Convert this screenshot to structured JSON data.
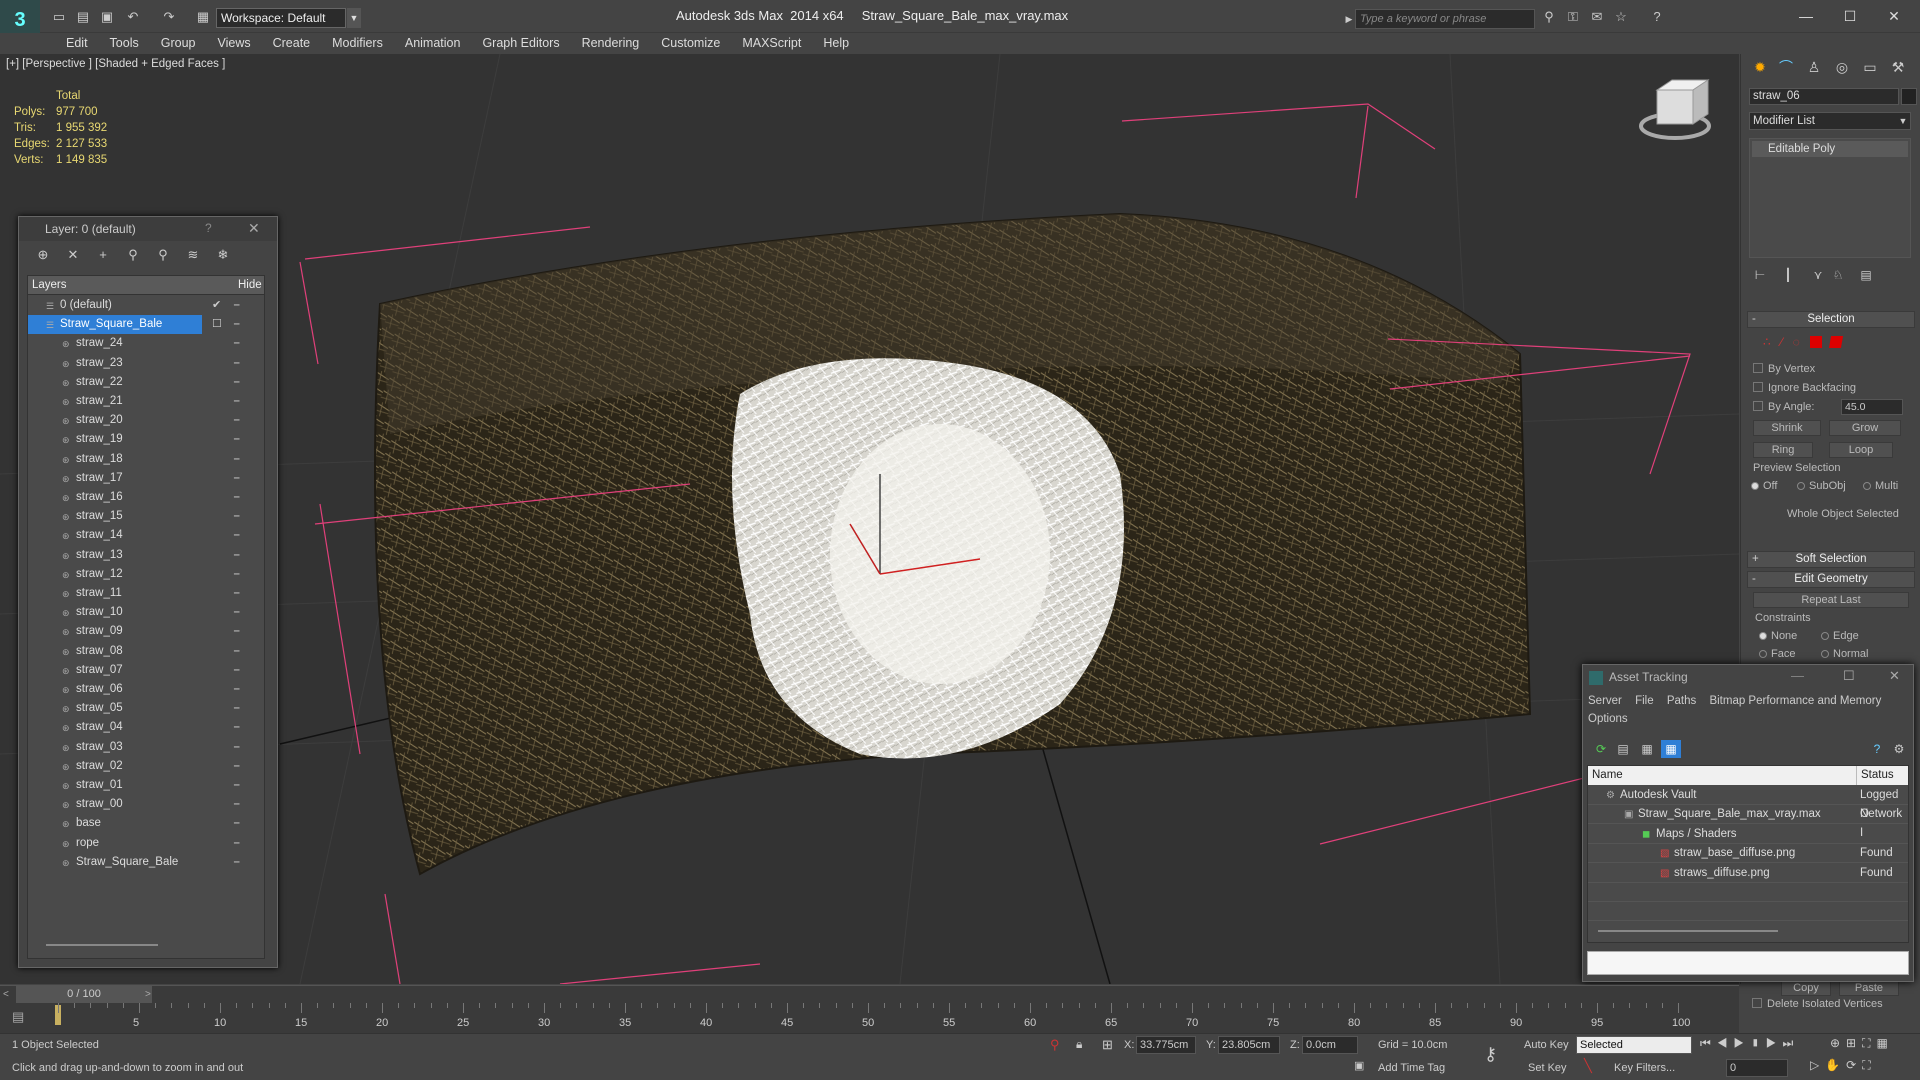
{
  "app": {
    "title": "Autodesk 3ds Max  2014 x64     Straw_Square_Bale_max_vray.max",
    "workspace": "Workspace: Default",
    "search_placeholder": "Type a keyword or phrase"
  },
  "menu": [
    "Edit",
    "Tools",
    "Group",
    "Views",
    "Create",
    "Modifiers",
    "Animation",
    "Graph Editors",
    "Rendering",
    "Customize",
    "MAXScript",
    "Help"
  ],
  "viewport": {
    "label": "[+] [Perspective ] [Shaded + Edged Faces ]",
    "stats": {
      "header": "Total",
      "rows": [
        {
          "label": "Polys:",
          "value": "977 700"
        },
        {
          "label": "Tris:",
          "value": "1 955 392"
        },
        {
          "label": "Edges:",
          "value": "2 127 533"
        },
        {
          "label": "Verts:",
          "value": "1 149 835"
        }
      ]
    }
  },
  "layer_panel": {
    "title": "Layer: 0 (default)",
    "help": "?",
    "col_layers": "Layers",
    "col_hide": "Hide",
    "rows": [
      {
        "name": "0 (default)",
        "level": 0
      },
      {
        "name": "Straw_Square_Bale",
        "level": 0
      },
      {
        "name": "straw_24",
        "level": 1
      },
      {
        "name": "straw_23",
        "level": 1
      },
      {
        "name": "straw_22",
        "level": 1
      },
      {
        "name": "straw_21",
        "level": 1
      },
      {
        "name": "straw_20",
        "level": 1
      },
      {
        "name": "straw_19",
        "level": 1
      },
      {
        "name": "straw_18",
        "level": 1
      },
      {
        "name": "straw_17",
        "level": 1
      },
      {
        "name": "straw_16",
        "level": 1
      },
      {
        "name": "straw_15",
        "level": 1
      },
      {
        "name": "straw_14",
        "level": 1
      },
      {
        "name": "straw_13",
        "level": 1
      },
      {
        "name": "straw_12",
        "level": 1
      },
      {
        "name": "straw_11",
        "level": 1
      },
      {
        "name": "straw_10",
        "level": 1
      },
      {
        "name": "straw_09",
        "level": 1
      },
      {
        "name": "straw_08",
        "level": 1
      },
      {
        "name": "straw_07",
        "level": 1
      },
      {
        "name": "straw_06",
        "level": 1
      },
      {
        "name": "straw_05",
        "level": 1
      },
      {
        "name": "straw_04",
        "level": 1
      },
      {
        "name": "straw_03",
        "level": 1
      },
      {
        "name": "straw_02",
        "level": 1
      },
      {
        "name": "straw_01",
        "level": 1
      },
      {
        "name": "straw_00",
        "level": 1
      },
      {
        "name": "base",
        "level": 1
      },
      {
        "name": "rope",
        "level": 1
      },
      {
        "name": "Straw_Square_Bale",
        "level": 1
      }
    ]
  },
  "command_panel": {
    "object_name": "straw_06",
    "modifier_list": "Modifier List",
    "stack_item": "Editable Poly",
    "selection": {
      "title": "Selection",
      "by_vertex": "By Vertex",
      "ignore_backfacing": "Ignore Backfacing",
      "by_angle": "By Angle:",
      "angle_value": "45.0",
      "shrink": "Shrink",
      "grow": "Grow",
      "ring": "Ring",
      "loop": "Loop",
      "preview_selection": "Preview Selection",
      "off": "Off",
      "subobj": "SubObj",
      "multi": "Multi",
      "whole_object": "Whole Object Selected"
    },
    "soft_selection": "Soft Selection",
    "edit_geometry": "Edit Geometry",
    "repeat_last": "Repeat Last",
    "constraints": "Constraints",
    "none": "None",
    "edge": "Edge",
    "face": "Face",
    "normal": "Normal",
    "copy": "Copy",
    "paste": "Paste",
    "delete_isolated": "Delete Isolated Vertices"
  },
  "asset_tracking": {
    "title": "Asset Tracking",
    "menu": [
      "Server",
      "File",
      "Paths",
      "Bitmap Performance and Memory",
      "Options"
    ],
    "col_name": "Name",
    "col_status": "Status",
    "rows": [
      {
        "name": "Autodesk Vault",
        "status": "Logged O",
        "level": 1
      },
      {
        "name": "Straw_Square_Bale_max_vray.max",
        "status": "Network I",
        "level": 2
      },
      {
        "name": "Maps / Shaders",
        "status": "",
        "level": 3
      },
      {
        "name": "straw_base_diffuse.png",
        "status": "Found",
        "level": 4
      },
      {
        "name": "straws_diffuse.png",
        "status": "Found",
        "level": 4
      }
    ]
  },
  "timeline": {
    "frame": "0 / 100",
    "ticks": [
      "5",
      "10",
      "15",
      "20",
      "25",
      "30",
      "35",
      "40",
      "45",
      "50",
      "55",
      "60",
      "65",
      "70",
      "75",
      "80",
      "85",
      "90",
      "95",
      "100"
    ]
  },
  "status": {
    "selected": "1 Object Selected",
    "prompt": "Click and drag up-and-down to zoom in and out",
    "x_label": "X:",
    "x": "33.775cm",
    "y_label": "Y:",
    "y": "23.805cm",
    "z_label": "Z:",
    "z": "0.0cm",
    "grid": "Grid = 10.0cm",
    "add_time_tag": "Add Time Tag",
    "auto_key": "Auto Key",
    "set_key": "Set Key",
    "key_mode": "Selected",
    "key_filters": "Key Filters...",
    "frame_field": "0"
  },
  "colors": {
    "selection_blue": "#2f7fd6",
    "stats_yellow": "#e8d872",
    "bbox_pink": "#e0407a"
  }
}
